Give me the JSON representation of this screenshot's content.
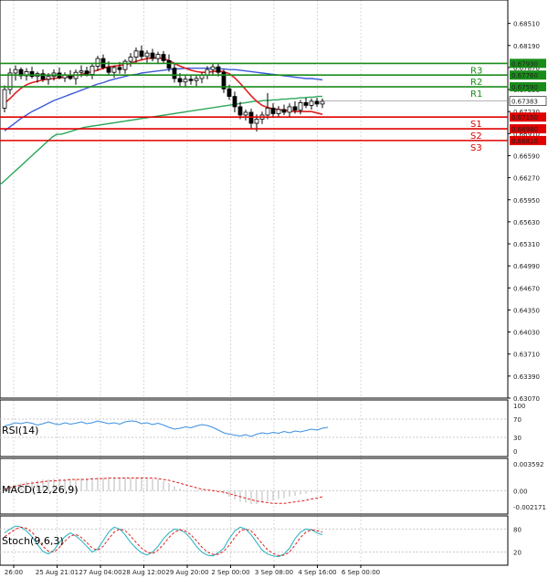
{
  "chart_data": {
    "type": "candlestick",
    "main": {
      "ylim": [
        0.6307,
        0.6885
      ],
      "y_ticks": [
        "0.68510",
        "0.68190",
        "0.67870",
        "0.67550",
        "0.67230",
        "0.66910",
        "0.66590",
        "0.66270",
        "0.65950",
        "0.65630",
        "0.65310",
        "0.64990",
        "0.64670",
        "0.64350",
        "0.64030",
        "0.63710",
        "0.63390",
        "0.63070"
      ],
      "last_price": "0.67383",
      "candles": [
        [
          0.6728,
          0.6761,
          0.6722,
          0.6755
        ],
        [
          0.6755,
          0.6786,
          0.6748,
          0.6779
        ],
        [
          0.6779,
          0.679,
          0.6768,
          0.6784
        ],
        [
          0.6784,
          0.6787,
          0.677,
          0.6775
        ],
        [
          0.6775,
          0.6786,
          0.6768,
          0.6781
        ],
        [
          0.6781,
          0.6788,
          0.6771,
          0.6774
        ],
        [
          0.6774,
          0.6781,
          0.6765,
          0.6778
        ],
        [
          0.6778,
          0.6784,
          0.6766,
          0.677
        ],
        [
          0.677,
          0.6779,
          0.6762,
          0.6774
        ],
        [
          0.6774,
          0.6784,
          0.6768,
          0.6779
        ],
        [
          0.6779,
          0.6787,
          0.677,
          0.6772
        ],
        [
          0.6772,
          0.678,
          0.6766,
          0.6776
        ],
        [
          0.6776,
          0.6783,
          0.6769,
          0.6771
        ],
        [
          0.6771,
          0.6784,
          0.6762,
          0.678
        ],
        [
          0.678,
          0.679,
          0.6773,
          0.6782
        ],
        [
          0.6782,
          0.6788,
          0.6774,
          0.6777
        ],
        [
          0.6777,
          0.6792,
          0.677,
          0.6789
        ],
        [
          0.6789,
          0.6804,
          0.6782,
          0.68
        ],
        [
          0.68,
          0.6806,
          0.6784,
          0.6787
        ],
        [
          0.6787,
          0.6796,
          0.6776,
          0.678
        ],
        [
          0.678,
          0.679,
          0.6772,
          0.6787
        ],
        [
          0.6787,
          0.6795,
          0.6778,
          0.6784
        ],
        [
          0.6784,
          0.6799,
          0.6778,
          0.6796
        ],
        [
          0.6796,
          0.6808,
          0.6788,
          0.6802
        ],
        [
          0.6802,
          0.6816,
          0.6794,
          0.6811
        ],
        [
          0.6811,
          0.6819,
          0.6798,
          0.6803
        ],
        [
          0.6803,
          0.6812,
          0.6794,
          0.6808
        ],
        [
          0.6808,
          0.6814,
          0.6796,
          0.68
        ],
        [
          0.68,
          0.681,
          0.6792,
          0.6806
        ],
        [
          0.6806,
          0.6811,
          0.6793,
          0.6797
        ],
        [
          0.6797,
          0.6806,
          0.6781,
          0.6786
        ],
        [
          0.6786,
          0.6792,
          0.6765,
          0.6771
        ],
        [
          0.6771,
          0.6779,
          0.676,
          0.6766
        ],
        [
          0.6766,
          0.6775,
          0.6758,
          0.677
        ],
        [
          0.677,
          0.6777,
          0.6762,
          0.6768
        ],
        [
          0.6768,
          0.6775,
          0.676,
          0.6771
        ],
        [
          0.6771,
          0.678,
          0.6764,
          0.6776
        ],
        [
          0.6776,
          0.6789,
          0.677,
          0.6784
        ],
        [
          0.6784,
          0.6793,
          0.6776,
          0.6788
        ],
        [
          0.6788,
          0.6792,
          0.6774,
          0.678
        ],
        [
          0.678,
          0.6784,
          0.675,
          0.6756
        ],
        [
          0.6756,
          0.6762,
          0.674,
          0.6745
        ],
        [
          0.6745,
          0.6752,
          0.6722,
          0.673
        ],
        [
          0.673,
          0.6737,
          0.6712,
          0.6718
        ],
        [
          0.6718,
          0.6726,
          0.671,
          0.6722
        ],
        [
          0.6722,
          0.6727,
          0.6698,
          0.6706
        ],
        [
          0.6706,
          0.6719,
          0.6694,
          0.6712
        ],
        [
          0.6712,
          0.6723,
          0.6705,
          0.6718
        ],
        [
          0.6718,
          0.675,
          0.6712,
          0.6728
        ],
        [
          0.6728,
          0.6735,
          0.6716,
          0.672
        ],
        [
          0.672,
          0.6731,
          0.6714,
          0.6726
        ],
        [
          0.6726,
          0.6733,
          0.6718,
          0.6722
        ],
        [
          0.6722,
          0.6735,
          0.6716,
          0.673
        ],
        [
          0.673,
          0.6738,
          0.672,
          0.6725
        ],
        [
          0.6725,
          0.674,
          0.6719,
          0.6736
        ],
        [
          0.6736,
          0.6743,
          0.6728,
          0.6732
        ],
        [
          0.6732,
          0.6742,
          0.6726,
          0.6738
        ],
        [
          0.6738,
          0.6743,
          0.673,
          0.6734
        ],
        [
          0.6734,
          0.6742,
          0.6728,
          0.6738
        ]
      ],
      "ma_fast": [
        0.6735,
        0.6742,
        0.675,
        0.6757,
        0.6762,
        0.6765,
        0.6767,
        0.6769,
        0.677,
        0.6771,
        0.6772,
        0.6773,
        0.6774,
        0.6775,
        0.6777,
        0.6779,
        0.6781,
        0.6783,
        0.6786,
        0.6788,
        0.6789,
        0.679,
        0.6791,
        0.6793,
        0.6796,
        0.6798,
        0.68,
        0.6801,
        0.6801,
        0.68,
        0.6797,
        0.6793,
        0.6789,
        0.6786,
        0.6783,
        0.6781,
        0.678,
        0.678,
        0.6781,
        0.6782,
        0.6781,
        0.6778,
        0.6772,
        0.6764,
        0.6755,
        0.6746,
        0.6738,
        0.6732,
        0.6729,
        0.6727,
        0.6726,
        0.6725,
        0.6724,
        0.6723,
        0.6723,
        0.6723,
        0.6723,
        0.6721,
        0.6719
      ],
      "ma_mid": [
        0.6695,
        0.6701,
        0.6707,
        0.6713,
        0.6718,
        0.6723,
        0.6727,
        0.6731,
        0.6735,
        0.6739,
        0.6742,
        0.6745,
        0.6748,
        0.6751,
        0.6754,
        0.6757,
        0.676,
        0.6763,
        0.6765,
        0.6768,
        0.677,
        0.6772,
        0.6774,
        0.6776,
        0.6777,
        0.6779,
        0.678,
        0.6781,
        0.6782,
        0.6783,
        0.6784,
        0.6785,
        0.6785,
        0.6786,
        0.6786,
        0.6786,
        0.6786,
        0.6786,
        0.6786,
        0.6785,
        0.6785,
        0.6784,
        0.6784,
        0.6783,
        0.6782,
        0.6781,
        0.678,
        0.6779,
        0.6778,
        0.6777,
        0.6776,
        0.6775,
        0.6774,
        0.6773,
        0.6772,
        0.6771,
        0.6771,
        0.677,
        0.6769
      ],
      "ma_slow": [
        0.669,
        0.6692,
        0.6694,
        0.6696,
        0.6698,
        0.67,
        0.6701,
        0.6702,
        0.6703,
        0.6704,
        0.6705,
        0.6706,
        0.6707,
        0.6708,
        0.6709,
        0.671,
        0.6711,
        0.6712,
        0.6713,
        0.6714,
        0.6715,
        0.6716,
        0.6717,
        0.6718,
        0.6719,
        0.672,
        0.6721,
        0.6722,
        0.6723,
        0.6724,
        0.6725,
        0.6726,
        0.6727,
        0.6728,
        0.6729,
        0.673,
        0.6731,
        0.6732,
        0.6733,
        0.6734,
        0.6735,
        0.6736,
        0.6737,
        0.6738,
        0.6738,
        0.6739,
        0.6739,
        0.674,
        0.674,
        0.6741,
        0.6741,
        0.6742,
        0.6742,
        0.6743,
        0.6743,
        0.6744,
        0.6744,
        0.6745,
        0.6745
      ],
      "ma_slow_history": [
        0.6615,
        0.662,
        0.6626,
        0.6632,
        0.6638,
        0.6644,
        0.665,
        0.6656,
        0.6662,
        0.6668,
        0.6674,
        0.668,
        0.6686,
        0.669
      ],
      "levels": [
        {
          "name": "R3",
          "value": 0.6793,
          "label": "0.67930",
          "color": "#1a8c1a"
        },
        {
          "name": "R2",
          "value": 0.6776,
          "label": "0.67760",
          "color": "#1a8c1a"
        },
        {
          "name": "R1",
          "value": 0.6759,
          "label": "0.67590",
          "color": "#1a8c1a"
        },
        {
          "name": "S1",
          "value": 0.6715,
          "label": "0.67150",
          "color": "#e00000"
        },
        {
          "name": "S2",
          "value": 0.6698,
          "label": "0.66980",
          "color": "#e00000"
        },
        {
          "name": "S3",
          "value": 0.6681,
          "label": "0.66810",
          "color": "#e00000"
        }
      ]
    },
    "x_ticks": [
      "26:00",
      "25 Aug 21:01",
      "27 Aug 04:00",
      "28 Aug 12:00",
      "29 Aug 20:00",
      "2 Sep 00:00",
      "3 Sep 08:00",
      "4 Sep 16:00",
      "6 Sep 00:00"
    ],
    "rsi": {
      "label": "RSI(14)",
      "ticks": [
        "100",
        "70",
        "30",
        "0"
      ],
      "values": [
        55,
        58,
        62,
        60,
        63,
        61,
        57,
        60,
        64,
        60,
        58,
        62,
        59,
        61,
        64,
        60,
        62,
        66,
        63,
        60,
        62,
        59,
        64,
        66,
        65,
        60,
        62,
        58,
        61,
        57,
        52,
        48,
        50,
        53,
        51,
        55,
        58,
        56,
        52,
        46,
        40,
        37,
        35,
        33,
        36,
        32,
        37,
        40,
        38,
        41,
        39,
        43,
        40,
        44,
        42,
        45,
        48,
        46,
        50,
        52
      ]
    },
    "macd": {
      "label": "MACD(12,26,9)",
      "ticks": [
        "0.003592",
        "0.00",
        "-0.002171"
      ],
      "histogram": [
        0.0004,
        0.0006,
        0.0008,
        0.001,
        0.0012,
        0.0013,
        0.0014,
        0.0015,
        0.0015,
        0.0016,
        0.0016,
        0.0016,
        0.0016,
        0.0016,
        0.0017,
        0.0017,
        0.0017,
        0.0018,
        0.0018,
        0.0018,
        0.0017,
        0.0017,
        0.0017,
        0.0017,
        0.0018,
        0.0018,
        0.0017,
        0.0016,
        0.0015,
        0.0013,
        0.001,
        0.0006,
        0.0003,
        0.0001,
        0.0,
        -0.0001,
        -0.0001,
        0.0,
        0.0001,
        0.0,
        -0.0004,
        -0.0008,
        -0.0012,
        -0.0015,
        -0.0016,
        -0.0018,
        -0.0018,
        -0.0016,
        -0.0014,
        -0.0013,
        -0.0011,
        -0.001,
        -0.0008,
        -0.0007,
        -0.0005,
        -0.0004,
        -0.0002,
        -0.0001,
        0.0
      ],
      "signal": [
        0.0002,
        0.0004,
        0.0006,
        0.0008,
        0.0009,
        0.001,
        0.0011,
        0.0012,
        0.0013,
        0.0013,
        0.0014,
        0.0014,
        0.0015,
        0.0015,
        0.0015,
        0.0015,
        0.0016,
        0.0016,
        0.0016,
        0.0017,
        0.0017,
        0.0017,
        0.0017,
        0.0017,
        0.0017,
        0.0017,
        0.0017,
        0.0017,
        0.0016,
        0.0015,
        0.0014,
        0.0012,
        0.001,
        0.0008,
        0.0006,
        0.0004,
        0.0002,
        0.0001,
        0.0,
        -0.0001,
        -0.0002,
        -0.0004,
        -0.0006,
        -0.0008,
        -0.001,
        -0.0012,
        -0.0014,
        -0.0015,
        -0.0016,
        -0.0017,
        -0.0017,
        -0.0017,
        -0.0016,
        -0.0015,
        -0.0014,
        -0.0013,
        -0.0011,
        -0.001,
        -0.0008
      ]
    },
    "stoch": {
      "label": "Stoch(9,6,3)",
      "ticks": [
        "80",
        "20"
      ],
      "k": [
        70,
        80,
        88,
        85,
        75,
        60,
        40,
        22,
        15,
        25,
        45,
        60,
        70,
        62,
        50,
        35,
        20,
        28,
        50,
        72,
        85,
        80,
        65,
        45,
        30,
        18,
        12,
        20,
        35,
        55,
        70,
        80,
        78,
        70,
        55,
        35,
        20,
        12,
        10,
        18,
        30,
        55,
        75,
        85,
        80,
        65,
        45,
        25,
        15,
        10,
        8,
        15,
        30,
        55,
        72,
        80,
        78,
        70,
        65
      ],
      "d": [
        60,
        70,
        80,
        85,
        82,
        72,
        55,
        35,
        22,
        20,
        32,
        48,
        62,
        66,
        58,
        45,
        30,
        25,
        35,
        55,
        72,
        80,
        76,
        62,
        45,
        30,
        20,
        16,
        25,
        40,
        58,
        72,
        78,
        75,
        65,
        50,
        33,
        20,
        14,
        14,
        22,
        38,
        58,
        75,
        80,
        75,
        60,
        42,
        26,
        16,
        11,
        12,
        20,
        38,
        58,
        72,
        78,
        76,
        72
      ]
    }
  }
}
